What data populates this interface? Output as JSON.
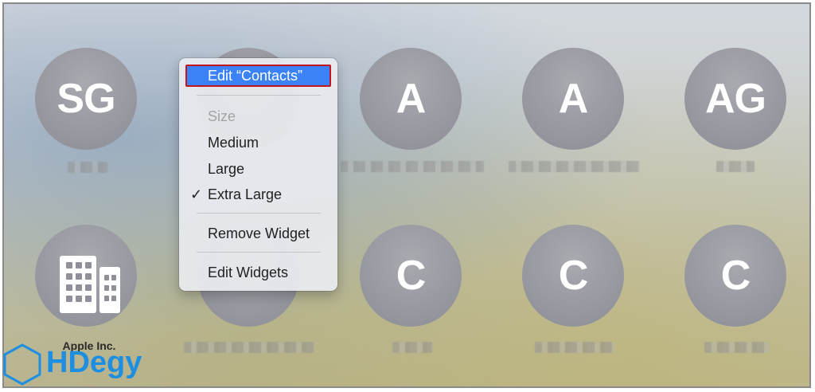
{
  "contacts_row1": [
    {
      "initials": "SG"
    },
    {
      "initials": ""
    },
    {
      "initials": "A"
    },
    {
      "initials": "A"
    },
    {
      "initials": "AG"
    }
  ],
  "contacts_row2": [
    {
      "label": "Apple Inc."
    },
    {
      "initials": "C"
    },
    {
      "initials": "C"
    },
    {
      "initials": "C"
    }
  ],
  "menu": {
    "edit_contacts": "Edit “Contacts”",
    "size_header": "Size",
    "medium": "Medium",
    "large": "Large",
    "extra_large": "Extra Large",
    "checkmark": "✓",
    "remove_widget": "Remove Widget",
    "edit_widgets": "Edit Widgets",
    "selected_size": "Extra Large"
  },
  "watermark": {
    "text": "HDegy"
  },
  "colors": {
    "menu_highlight": "#3b82f6",
    "highlight_border": "#c0171e",
    "avatar": "#94959d",
    "watermark": "#1e8fe0"
  }
}
